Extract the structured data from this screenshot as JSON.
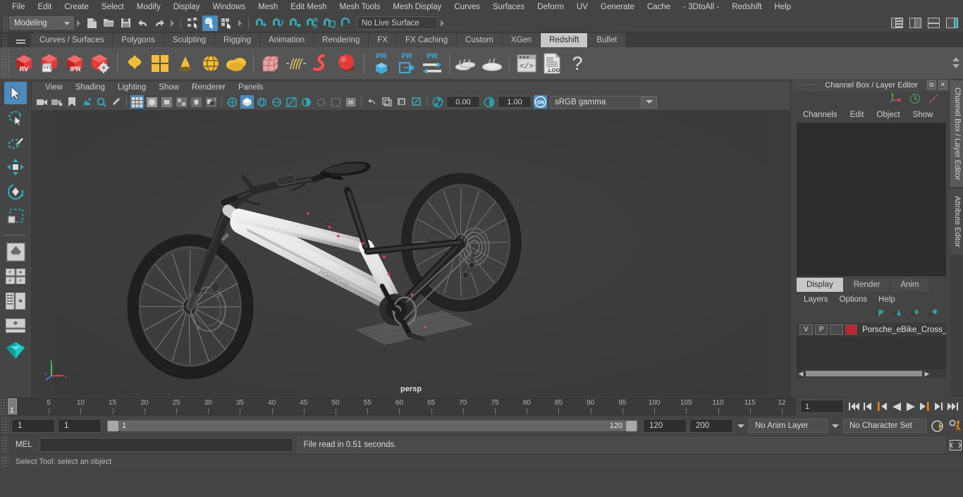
{
  "menubar": {
    "items": [
      "File",
      "Edit",
      "Create",
      "Select",
      "Modify",
      "Display",
      "Windows",
      "Mesh",
      "Edit Mesh",
      "Mesh Tools",
      "Mesh Display",
      "Curves",
      "Surfaces",
      "Deform",
      "UV",
      "Generate",
      "Cache",
      "- 3DtoAll -",
      "Redshift",
      "Help"
    ]
  },
  "statusline": {
    "menu_set": "Modeling",
    "live_surface": "No Live Surface"
  },
  "shelf": {
    "tabs": [
      "Curves / Surfaces",
      "Polygons",
      "Sculpting",
      "Rigging",
      "Animation",
      "Rendering",
      "FX",
      "FX Caching",
      "Custom",
      "XGen",
      "Redshift",
      "Bullet"
    ],
    "active_tab": "Redshift",
    "buttons": [
      "rv-render-view",
      "rv-animation-render",
      "ipr-render",
      "render-settings",
      "redshift-proxy",
      "redshift-matte",
      "redshift-sprite",
      "redshift-dome",
      "redshift-volume",
      "redshift-mesh-params",
      "redshift-hair",
      "redshift-curve",
      "redshift-sphere",
      "pr-object",
      "pr-export",
      "pr-transfer",
      "bake-set",
      "bake-all",
      "script-editor",
      "render-log",
      "help"
    ]
  },
  "toolbox": {
    "tools": [
      "select-tool",
      "lasso-select-tool",
      "paint-select-tool",
      "move-tool",
      "rotate-tool",
      "scale-tool",
      "last-tool",
      "snap-grid",
      "snap-curve",
      "snap-point",
      "snap-view",
      "outliner-persp-layout",
      "persp-layout",
      "four-view-layout"
    ],
    "active": "select-tool"
  },
  "viewport": {
    "menus": [
      "View",
      "Shading",
      "Lighting",
      "Show",
      "Renderer",
      "Panels"
    ],
    "exposure": "0.00",
    "gamma": "1.00",
    "color_space": "sRGB gamma",
    "camera_label": "persp",
    "axis": {
      "x": "x",
      "y": "y",
      "z": "z"
    }
  },
  "channelbox": {
    "title": "Channel Box / Layer Editor",
    "menus": [
      "Channels",
      "Edit",
      "Object",
      "Show"
    ]
  },
  "layer_editor": {
    "tabs": [
      "Display",
      "Render",
      "Anim"
    ],
    "active_tab": "Display",
    "menus": [
      "Layers",
      "Options",
      "Help"
    ],
    "layers": [
      {
        "visible": "V",
        "playback": "P",
        "state": "",
        "color": "#c32432",
        "name": "Porsche_eBike_Cross_V"
      }
    ]
  },
  "timeline": {
    "start": 1,
    "end": 120,
    "current_frame": "1",
    "tick_labels": [
      "5",
      "10",
      "15",
      "20",
      "25",
      "30",
      "35",
      "40",
      "45",
      "50",
      "55",
      "60",
      "65",
      "70",
      "75",
      "80",
      "85",
      "90",
      "95",
      "100",
      "105",
      "110",
      "115",
      "12"
    ],
    "playhead_label": "1",
    "playback_buttons": [
      "go-to-start",
      "step-back-keyframe",
      "step-back-frame",
      "play-backwards",
      "play-forwards",
      "step-forward-frame",
      "step-forward-keyframe",
      "go-to-end"
    ]
  },
  "range": {
    "anim_start": "1",
    "range_start": "1",
    "slider_min_label": "1",
    "slider_max_label": "120",
    "range_end": "120",
    "anim_end": "200",
    "anim_layer": "No Anim Layer",
    "character_set": "No Character Set"
  },
  "mel": {
    "label": "MEL",
    "command": "",
    "message": "File read in  0.51 seconds."
  },
  "status": {
    "help_text": "Select Tool: select an object"
  },
  "colors": {
    "accent": "#4b8bbd",
    "background": "#444444",
    "panel": "#4a4a4a",
    "field": "#333333",
    "layer_red": "#c32432",
    "orange": "#e08214",
    "teal": "#2aa5a5"
  }
}
